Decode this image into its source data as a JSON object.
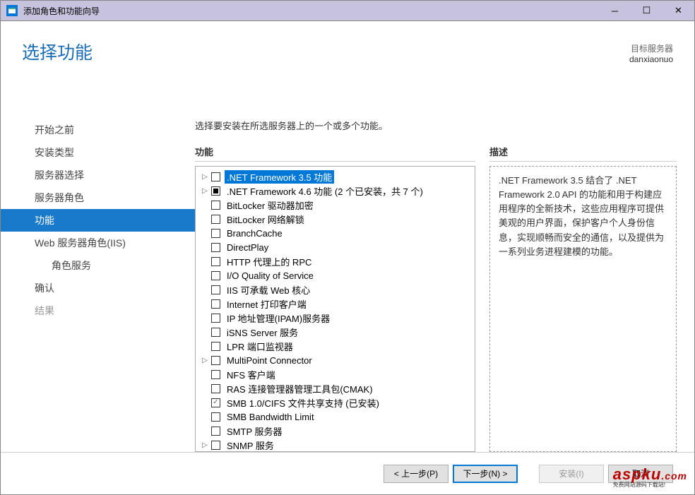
{
  "window": {
    "title": "添加角色和功能向导"
  },
  "header": {
    "title": "选择功能",
    "target_label": "目标服务器",
    "target_name": "danxiaonuo"
  },
  "steps": [
    {
      "label": "开始之前",
      "active": false,
      "sub": false
    },
    {
      "label": "安装类型",
      "active": false,
      "sub": false
    },
    {
      "label": "服务器选择",
      "active": false,
      "sub": false
    },
    {
      "label": "服务器角色",
      "active": false,
      "sub": false
    },
    {
      "label": "功能",
      "active": true,
      "sub": false
    },
    {
      "label": "Web 服务器角色(IIS)",
      "active": false,
      "sub": false
    },
    {
      "label": "角色服务",
      "active": false,
      "sub": true
    },
    {
      "label": "确认",
      "active": false,
      "sub": false
    },
    {
      "label": "结果",
      "active": false,
      "sub": false,
      "disabled": true
    }
  ],
  "main": {
    "instruction": "选择要安装在所选服务器上的一个或多个功能。",
    "features_header": "功能",
    "description_header": "描述",
    "description_text": ".NET Framework 3.5 结合了 .NET Framework 2.0 API 的功能和用于构建应用程序的全新技术，这些应用程序可提供美观的用户界面，保护客户个人身份信息，实现顺畅而安全的通信，以及提供为一系列业务进程建模的功能。"
  },
  "features": [
    {
      "label": ".NET Framework 3.5 功能",
      "expander": "▷",
      "check": "unchecked",
      "selected": true
    },
    {
      "label": ".NET Framework 4.6 功能 (2 个已安装，共 7 个)",
      "expander": "▷",
      "check": "partial"
    },
    {
      "label": "BitLocker 驱动器加密",
      "expander": "",
      "check": "unchecked"
    },
    {
      "label": "BitLocker 网络解锁",
      "expander": "",
      "check": "unchecked"
    },
    {
      "label": "BranchCache",
      "expander": "",
      "check": "unchecked"
    },
    {
      "label": "DirectPlay",
      "expander": "",
      "check": "unchecked"
    },
    {
      "label": "HTTP 代理上的 RPC",
      "expander": "",
      "check": "unchecked"
    },
    {
      "label": "I/O Quality of Service",
      "expander": "",
      "check": "unchecked"
    },
    {
      "label": "IIS 可承载 Web 核心",
      "expander": "",
      "check": "unchecked"
    },
    {
      "label": "Internet 打印客户端",
      "expander": "",
      "check": "unchecked"
    },
    {
      "label": "IP 地址管理(IPAM)服务器",
      "expander": "",
      "check": "unchecked"
    },
    {
      "label": "iSNS Server 服务",
      "expander": "",
      "check": "unchecked"
    },
    {
      "label": "LPR 端口监视器",
      "expander": "",
      "check": "unchecked"
    },
    {
      "label": "MultiPoint Connector",
      "expander": "▷",
      "check": "unchecked"
    },
    {
      "label": "NFS 客户端",
      "expander": "",
      "check": "unchecked"
    },
    {
      "label": "RAS 连接管理器管理工具包(CMAK)",
      "expander": "",
      "check": "unchecked"
    },
    {
      "label": "SMB 1.0/CIFS 文件共享支持 (已安装)",
      "expander": "",
      "check": "checked"
    },
    {
      "label": "SMB Bandwidth Limit",
      "expander": "",
      "check": "unchecked"
    },
    {
      "label": "SMTP 服务器",
      "expander": "",
      "check": "unchecked"
    },
    {
      "label": "SNMP 服务",
      "expander": "▷",
      "check": "unchecked"
    }
  ],
  "buttons": {
    "prev": "< 上一步(P)",
    "next": "下一步(N) >",
    "install": "安装(I)",
    "cancel": "取消"
  },
  "watermark": {
    "main": "aspku",
    "suffix": ".com",
    "sub": "免费网站源码下载站!"
  }
}
